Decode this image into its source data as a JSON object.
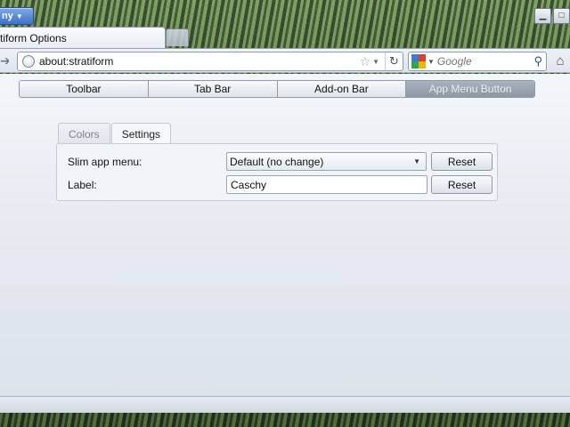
{
  "window": {
    "app_menu_label": "ny",
    "minimize_glyph": "▁",
    "maximize_glyph": "□"
  },
  "tabs": [
    {
      "label": "tiform Options",
      "active": true
    }
  ],
  "nav": {
    "url": "about:stratiform",
    "search_placeholder": "Google",
    "icons": [
      "back-icon",
      "site-icon",
      "star-icon",
      "reload-icon",
      "search-engine-icon",
      "magnifier-icon",
      "home-icon"
    ]
  },
  "options": {
    "section_tabs": [
      {
        "label": "Toolbar",
        "selected": false
      },
      {
        "label": "Tab Bar",
        "selected": false
      },
      {
        "label": "Add-on Bar",
        "selected": false
      },
      {
        "label": "App Menu Button",
        "selected": true
      }
    ],
    "sub_tabs": [
      {
        "label": "Colors",
        "selected": false
      },
      {
        "label": "Settings",
        "selected": true
      }
    ],
    "settings": {
      "slim_menu_label": "Slim app menu:",
      "slim_menu_value": "Default (no change)",
      "label_label": "Label:",
      "label_value": "Caschy",
      "reset_label": "Reset"
    }
  },
  "colors": {
    "accent": "#3f73c8",
    "selected_tab": "#9aa3af"
  }
}
